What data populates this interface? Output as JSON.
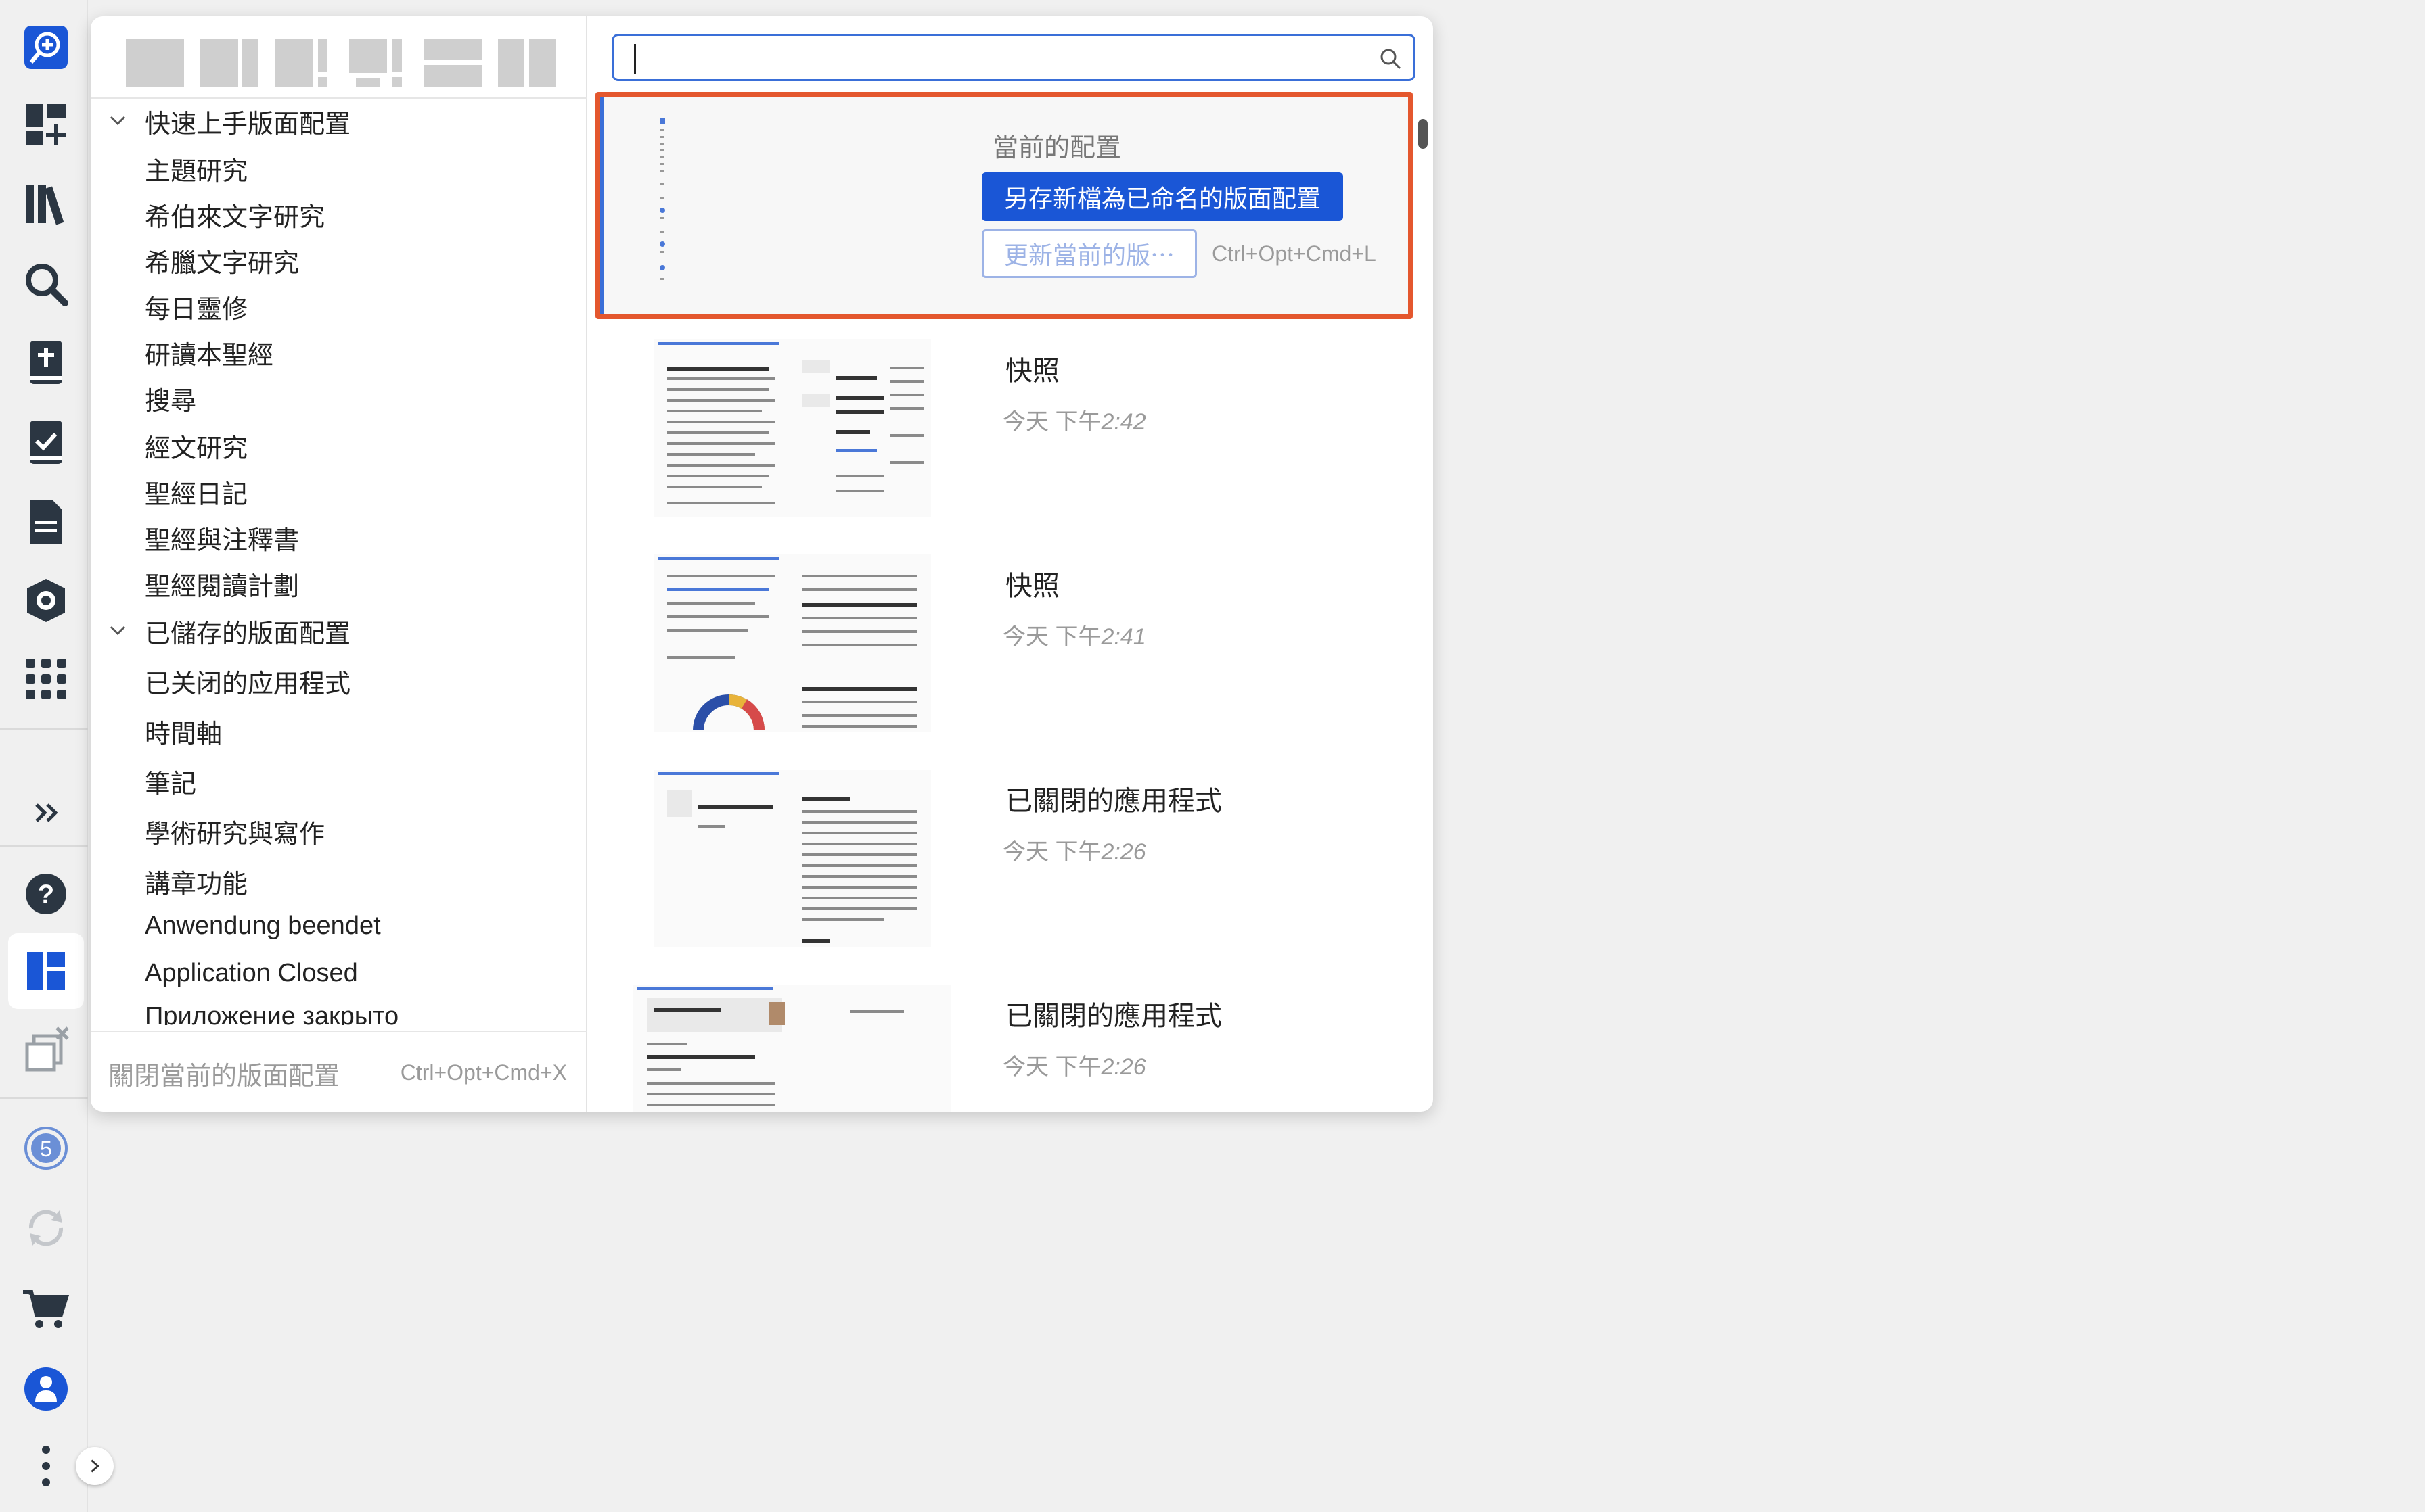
{
  "left_panel": {
    "layout_buttons": [
      "layout-single",
      "layout-two-cols",
      "layout-two-cols-split",
      "layout-grid-split",
      "layout-two-rows",
      "layout-side-by-side"
    ],
    "tree": [
      {
        "type": "group",
        "label": "快速上手版面配置",
        "expanded": true
      },
      {
        "type": "item",
        "label": "主題研究"
      },
      {
        "type": "item",
        "label": "希伯來文字研究"
      },
      {
        "type": "item",
        "label": "希臘文字研究"
      },
      {
        "type": "item",
        "label": "每日靈修"
      },
      {
        "type": "item",
        "label": "研讀本聖經"
      },
      {
        "type": "item",
        "label": "搜尋"
      },
      {
        "type": "item",
        "label": "經文研究"
      },
      {
        "type": "item",
        "label": "聖經日記"
      },
      {
        "type": "item",
        "label": "聖經與注釋書"
      },
      {
        "type": "item",
        "label": "聖經閱讀計劃"
      },
      {
        "type": "group",
        "label": "已儲存的版面配置",
        "expanded": true
      },
      {
        "type": "item",
        "label": "已关闭的应用程式"
      },
      {
        "type": "item",
        "label": "時間軸"
      },
      {
        "type": "item",
        "label": "筆記"
      },
      {
        "type": "item",
        "label": "學術研究與寫作"
      },
      {
        "type": "item",
        "label": "講章功能"
      },
      {
        "type": "item",
        "label": "Anwendung beendet"
      },
      {
        "type": "item",
        "label": "Application Closed"
      },
      {
        "type": "item",
        "label": "Приложение закрыто"
      }
    ],
    "footer": {
      "close_label": "關閉當前的版面配置",
      "close_shortcut": "Ctrl+Opt+Cmd+X"
    }
  },
  "search": {
    "value": "",
    "placeholder": ""
  },
  "current": {
    "title": "當前的配置",
    "save_label": "另存新檔為已命名的版面配置",
    "update_label": "更新當前的版⋯",
    "update_shortcut": "Ctrl+Opt+Cmd+L"
  },
  "entries": [
    {
      "title": "快照",
      "day": "今天 下午",
      "time": "2:42"
    },
    {
      "title": "快照",
      "day": "今天 下午",
      "time": "2:41"
    },
    {
      "title": "已關閉的應用程式",
      "day": "今天 下午",
      "time": "2:26"
    },
    {
      "title": "已關閉的應用程式",
      "day": "今天 下午",
      "time": "2:26"
    }
  ],
  "rail": {
    "icons": [
      "new-tab-icon",
      "dashboard-add-icon",
      "library-icon",
      "search-icon",
      "bible-icon",
      "checklist-icon",
      "document-icon",
      "factbook-icon",
      "apps-grid-icon",
      "expand-icon",
      "help-icon",
      "layouts-icon",
      "closed-windows-icon",
      "notifications-icon",
      "sync-icon",
      "cart-icon",
      "account-icon",
      "more-icon"
    ],
    "badge_count": "5",
    "accent": "#1a56d6"
  }
}
